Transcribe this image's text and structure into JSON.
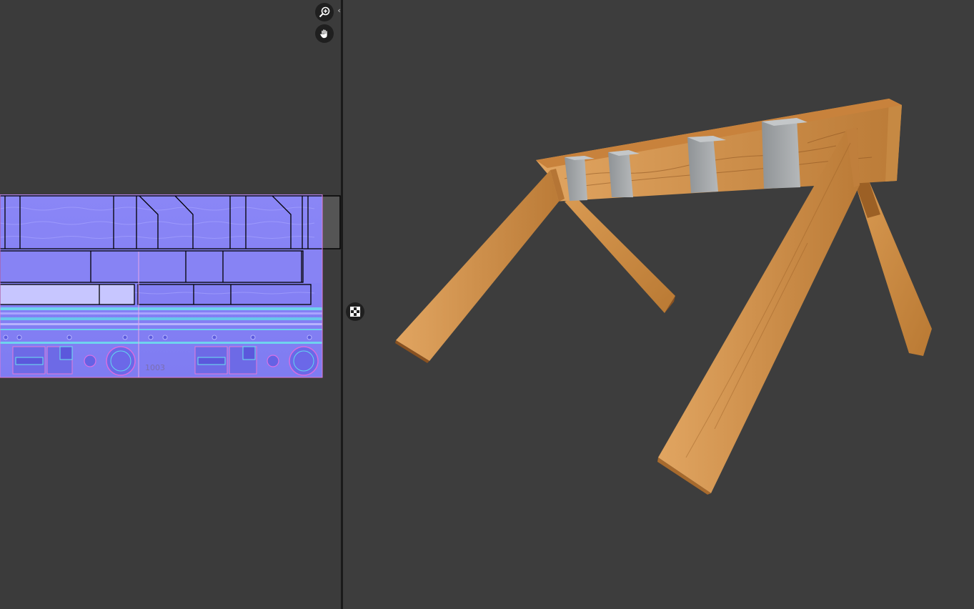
{
  "uv_editor": {
    "tile_label": "1003",
    "zoom_icon": "zoom-in-icon",
    "pan_icon": "hand-pan-icon",
    "expand_icon": "expand-arrows-icon",
    "checker_icon": "checker-toggle-icon"
  },
  "viewport": {
    "model": "wooden-sawhorse",
    "wood_color": "#c98a44",
    "metal_color": "#a4a8ab"
  }
}
